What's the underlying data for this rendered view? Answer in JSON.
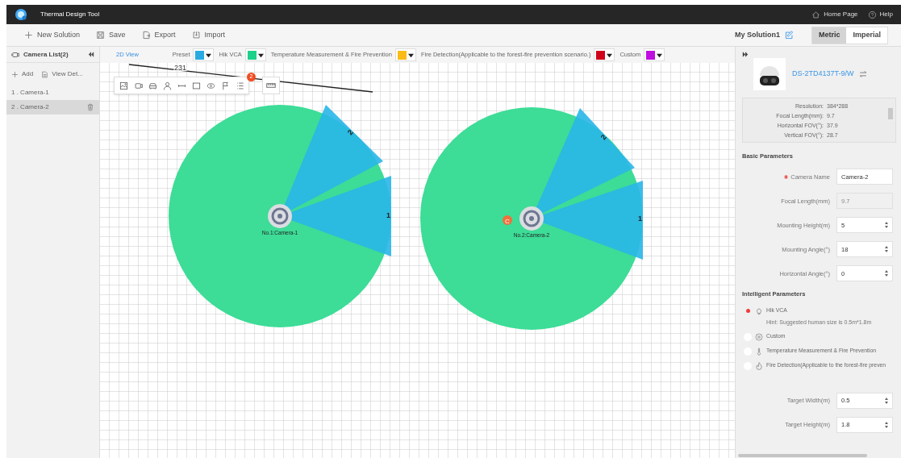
{
  "app": {
    "title": "Thermal Design Tool",
    "links": [
      {
        "kind": "home",
        "label": "Home Page"
      },
      {
        "kind": "help",
        "label": "Help"
      }
    ]
  },
  "toolbar": {
    "actions": [
      {
        "kind": "new",
        "label": "New Solution"
      },
      {
        "kind": "save",
        "label": "Save"
      },
      {
        "kind": "export",
        "label": "Export"
      },
      {
        "kind": "import",
        "label": "Import"
      }
    ],
    "solution_name": "My Solution1",
    "units": [
      {
        "label": "Metric",
        "selected": true
      },
      {
        "label": "Imperial",
        "selected": false
      }
    ]
  },
  "sidebar": {
    "title": "Camera List(2)",
    "actions": [
      {
        "kind": "add",
        "label": "Add"
      },
      {
        "kind": "details",
        "label": "View Det..."
      }
    ],
    "cameras": [
      {
        "label": "1 . Camera-1",
        "selected": false
      },
      {
        "label": "2 . Camera-2",
        "selected": true
      }
    ]
  },
  "legend": {
    "view_tab": "2D View",
    "items": [
      {
        "label": "Preset",
        "color": "#29abe2"
      },
      {
        "label": "Hik VCA",
        "color": "#1ed18a"
      },
      {
        "label": "Temperature Measurement & Fire Prevention",
        "color": "#fbbc17"
      },
      {
        "label": "Fire Detection(Applicable to the forest-fire prevention scenario.)",
        "color": "#d0021b"
      },
      {
        "label": "Custom",
        "color": "#c00ee0"
      }
    ]
  },
  "canvas": {
    "measurement": "231",
    "tool_badge": "2",
    "marker": "C",
    "cameras": [
      {
        "label": "No.1:Camera-1",
        "zones": [
          "2",
          "1"
        ]
      },
      {
        "label": "No.2:Camera-2",
        "zones": [
          "2",
          "1"
        ]
      }
    ]
  },
  "panel": {
    "model": "DS-2TD4137T-9/W",
    "specs": [
      {
        "label": "Resolution:",
        "value": "384*288"
      },
      {
        "label": "Focal Length(mm):",
        "value": "9.7"
      },
      {
        "label": "Horizontal FOV(°):",
        "value": "37.9"
      },
      {
        "label": "Vertical FOV(°):",
        "value": "28.7"
      }
    ],
    "basic_title": "Basic Parameters",
    "basic_fields": [
      {
        "label": "Camera Name",
        "value": "Camera-2",
        "kind": "text",
        "required": true
      },
      {
        "label": "Focal Length(mm)",
        "value": "9.7",
        "kind": "disabled",
        "required": false
      },
      {
        "label": "Mounting Height(m)",
        "value": "5",
        "kind": "number",
        "required": false
      },
      {
        "label": "Mounting Angle(°)",
        "value": "18",
        "kind": "number",
        "required": false
      },
      {
        "label": "Horizontal Angle(°)",
        "value": "0",
        "kind": "number",
        "required": false
      }
    ],
    "intelligent_title": "Intelligent Parameters",
    "options": [
      {
        "kind": "bulb",
        "label": "Hik VCA",
        "selected": true,
        "hint": "Hint: Suggested human size is 0.5m*1.8m"
      },
      {
        "kind": "gear",
        "label": "Custom",
        "selected": false
      },
      {
        "kind": "thermometer",
        "label": "Temperature Measurement & Fire Prevention",
        "selected": false
      },
      {
        "kind": "flame",
        "label": "Fire Detection(Applicable to the forest-fire preven",
        "selected": false
      }
    ],
    "target_fields": [
      {
        "label": "Target Width(m)",
        "value": "0.5",
        "kind": "number",
        "required": false
      },
      {
        "label": "Target Height(m)",
        "value": "1.8",
        "kind": "number",
        "required": false
      }
    ]
  }
}
